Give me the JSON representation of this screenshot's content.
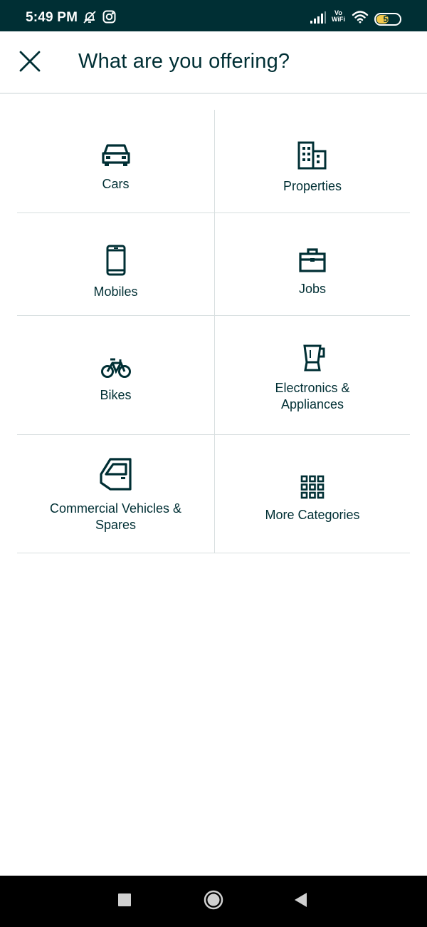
{
  "status_bar": {
    "time": "5:49 PM",
    "battery": "50",
    "vowifi_top": "Vo",
    "vowifi_bottom": "WiFi",
    "icons": [
      "bell-off-icon",
      "instagram-icon",
      "signal-icon",
      "vowifi-icon",
      "wifi-icon",
      "battery-icon"
    ]
  },
  "header": {
    "title": "What are you offering?",
    "close_icon": "close-icon"
  },
  "categories": [
    {
      "label_line1": "Cars",
      "label_line2": "",
      "icon": "car-icon"
    },
    {
      "label_line1": "Properties",
      "label_line2": "",
      "icon": "building-icon"
    },
    {
      "label_line1": "Mobiles",
      "label_line2": "",
      "icon": "mobile-icon"
    },
    {
      "label_line1": "Jobs",
      "label_line2": "",
      "icon": "briefcase-icon"
    },
    {
      "label_line1": "Bikes",
      "label_line2": "",
      "icon": "bicycle-icon"
    },
    {
      "label_line1": "Electronics &",
      "label_line2": "Appliances",
      "icon": "blender-icon"
    },
    {
      "label_line1": "Commercial Vehicles &",
      "label_line2": "Spares",
      "icon": "vehicle-door-icon"
    },
    {
      "label_line1": "More Categories",
      "label_line2": "",
      "icon": "grid-icon"
    }
  ],
  "nav_bar": {
    "buttons": [
      "recents-square-icon",
      "home-circle-icon",
      "back-triangle-icon"
    ]
  },
  "colors": {
    "brand_dark": "#002f34",
    "divider": "#d8dfe0",
    "battery_fill": "#f2c94c",
    "nav_background": "#000000"
  }
}
